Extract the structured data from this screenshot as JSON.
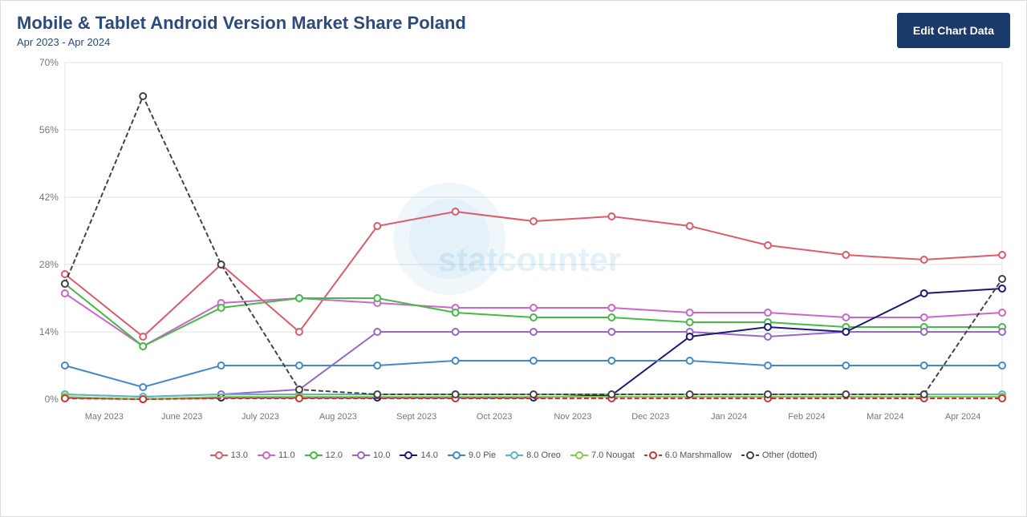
{
  "header": {
    "main_title": "Mobile & Tablet Android Version Market Share Poland",
    "subtitle": "Apr 2023 - Apr 2024",
    "edit_button_label": "Edit Chart Data"
  },
  "chart": {
    "y_labels": [
      "0%",
      "14%",
      "28%",
      "42%",
      "56%",
      "70%"
    ],
    "x_labels": [
      "May 2023",
      "June 2023",
      "July 2023",
      "Aug 2023",
      "Sept 2023",
      "Oct 2023",
      "Nov 2023",
      "Dec 2023",
      "Jan 2024",
      "Feb 2024",
      "Mar 2024",
      "Apr 2024"
    ],
    "watermark": "statcounter",
    "series": [
      {
        "name": "13.0",
        "color": "#e05a6a",
        "dotted": false
      },
      {
        "name": "11.0",
        "color": "#cc66cc",
        "dotted": false
      },
      {
        "name": "12.0",
        "color": "#44bb44",
        "dotted": false
      },
      {
        "name": "10.0",
        "color": "#9966cc",
        "dotted": false
      },
      {
        "name": "14.0",
        "color": "#333399",
        "dotted": false
      },
      {
        "name": "9.0 Pie",
        "color": "#4488cc",
        "dotted": false
      },
      {
        "name": "8.0 Oreo",
        "color": "#55bbbb",
        "dotted": false
      },
      {
        "name": "7.0 Nougat",
        "color": "#88cc44",
        "dotted": false
      },
      {
        "name": "6.0 Marshmallow",
        "color": "#cc3333",
        "dotted": true
      },
      {
        "name": "Other (dotted)",
        "color": "#333333",
        "dotted": true
      }
    ]
  },
  "legend": {
    "items": [
      {
        "label": "13.0",
        "color": "#e05a6a"
      },
      {
        "label": "11.0",
        "color": "#cc66cc"
      },
      {
        "label": "12.0",
        "color": "#44bb44"
      },
      {
        "label": "10.0",
        "color": "#9966cc"
      },
      {
        "label": "14.0",
        "color": "#333399"
      },
      {
        "label": "9.0 Pie",
        "color": "#4488cc"
      },
      {
        "label": "8.0 Oreo",
        "color": "#55bbbb"
      },
      {
        "label": "7.0 Nougat",
        "color": "#88cc44"
      },
      {
        "label": "6.0 Marshmallow",
        "color": "#cc3333",
        "dotted": true
      },
      {
        "label": "Other (dotted)",
        "color": "#333333",
        "dotted": true
      }
    ]
  }
}
